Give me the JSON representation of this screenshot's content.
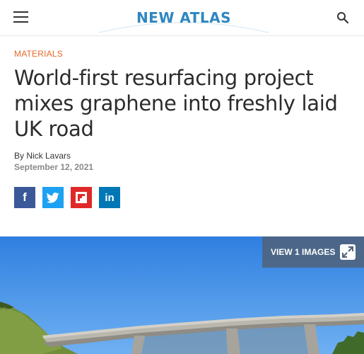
{
  "header": {
    "logo_text": "NEW ATLAS"
  },
  "article": {
    "category": "MATERIALS",
    "title": "World-first resurfacing project mixes graphene into freshly laid UK road",
    "byline": "By Nick Lavars",
    "date": "September 12, 2021"
  },
  "share": {
    "facebook": "f",
    "twitter": "twitter-icon",
    "flipboard": "flipboard-icon",
    "linkedin": "in"
  },
  "gallery": {
    "label": "VIEW 1 IMAGES"
  }
}
